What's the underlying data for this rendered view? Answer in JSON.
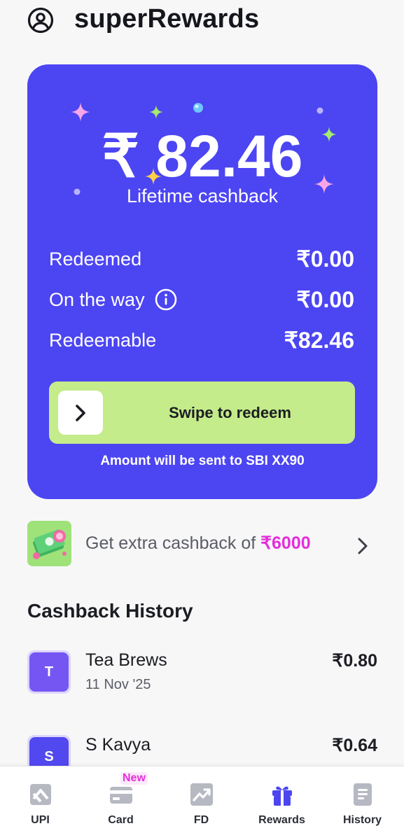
{
  "header": {
    "title": "superRewards",
    "profile_icon": "profile-icon"
  },
  "rewards_card": {
    "amount": "₹ 82.46",
    "amount_label": "Lifetime cashback",
    "background": "#4c45f2",
    "rows": [
      {
        "label": "Redeemed",
        "value": "₹0.00"
      },
      {
        "label": "On the way",
        "value": "₹0.00",
        "icon": "info-icon"
      },
      {
        "label": "Redeemable",
        "value": "₹82.46"
      }
    ],
    "swipe": {
      "label": "Swipe to redeem",
      "handle_icon": "chevron-right-icon",
      "color": "#c4ec8b"
    },
    "destination": "Amount will be sent to SBI XX90"
  },
  "promo": {
    "text": "Get extra cashback of ",
    "amount": "₹6000",
    "amount_color": "#e52ddc",
    "icon": "cash-stack-icon"
  },
  "history": {
    "title": "Cashback History",
    "items": [
      {
        "initial": "T",
        "name": "Tea Brews",
        "date": "11 Nov '25",
        "amount": "₹0.80"
      },
      {
        "initial": "S",
        "name": "S Kavya",
        "date": "",
        "amount": "₹0.64"
      }
    ]
  },
  "nav": {
    "items": [
      {
        "label": "UPI",
        "icon": "upi-icon"
      },
      {
        "label": "Card",
        "icon": "card-icon",
        "badge": "New"
      },
      {
        "label": "FD",
        "icon": "chart-up-icon"
      },
      {
        "label": "Rewards",
        "icon": "gift-icon",
        "active": true
      },
      {
        "label": "History",
        "icon": "document-icon"
      }
    ]
  }
}
